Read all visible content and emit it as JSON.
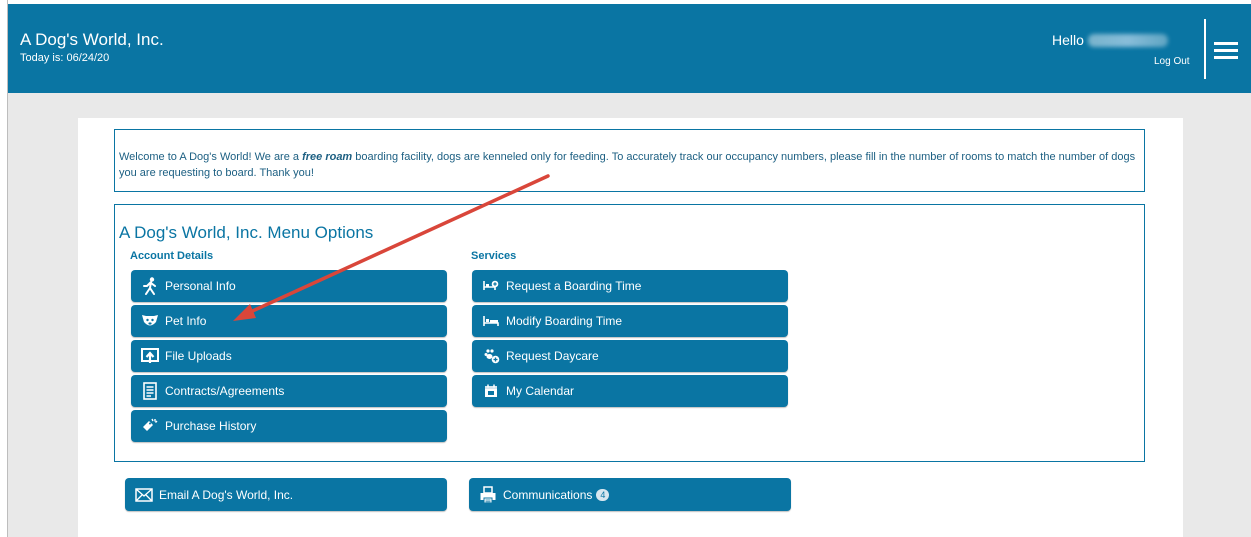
{
  "header": {
    "brand": "A Dog's World, Inc.",
    "today": "Today is: 06/24/20",
    "hello": "Hello",
    "logout": "Log Out"
  },
  "welcome": {
    "part1": "Welcome to A Dog's World! We are a ",
    "emphasis": "free roam",
    "part2": " boarding facility, dogs are kenneled only for feeding. To accurately track our occupancy numbers, please fill in the number of rooms to match the number of dogs you are requesting to board.  Thank you!"
  },
  "menu": {
    "title": "A Dog's World, Inc. Menu Options",
    "account_label": "Account Details",
    "services_label": "Services",
    "account_items": [
      {
        "label": "Personal Info",
        "icon": "running-person-icon"
      },
      {
        "label": "Pet Info",
        "icon": "dog-face-icon"
      },
      {
        "label": "File Uploads",
        "icon": "upload-icon"
      },
      {
        "label": "Contracts/Agreements",
        "icon": "document-icon"
      },
      {
        "label": "Purchase History",
        "icon": "price-tag-icon"
      }
    ],
    "service_items": [
      {
        "label": "Request a Boarding Time",
        "icon": "bed-plus-icon"
      },
      {
        "label": "Modify Boarding Time",
        "icon": "bed-icon"
      },
      {
        "label": "Request Daycare",
        "icon": "paws-plus-icon"
      },
      {
        "label": "My Calendar",
        "icon": "calendar-icon"
      }
    ]
  },
  "footer_buttons": {
    "email": "Email A Dog's World, Inc.",
    "communications": "Communications",
    "communications_count": "4"
  },
  "colors": {
    "primary": "#0a75a3",
    "annotation_arrow": "#d9463a"
  }
}
